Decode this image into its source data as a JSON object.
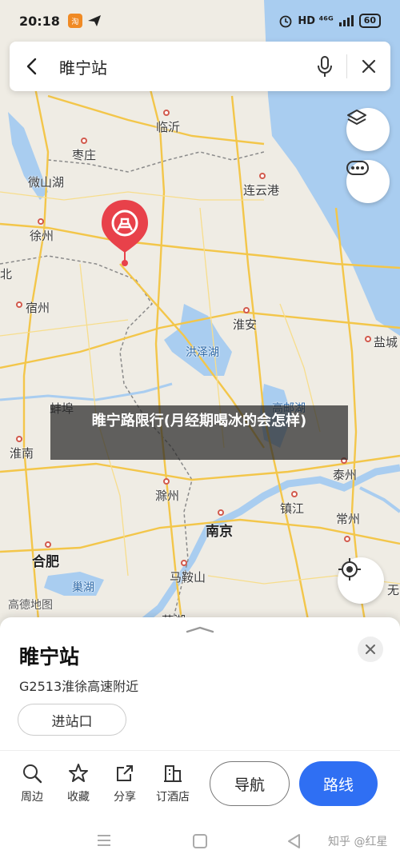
{
  "status_bar": {
    "time": "20:18",
    "network": "HD ⁴⁶ᴳ",
    "battery": "60"
  },
  "search": {
    "query": "睢宁站"
  },
  "map": {
    "cities": {
      "linyi": "临沂",
      "zaozhuang": "枣庄",
      "weishanhu": "微山湖",
      "lianyungang": "连云港",
      "xuzhou": "徐州",
      "bei": "北",
      "suzhou_ah": "宿州",
      "huaian": "淮安",
      "hongzehu": "洪泽湖",
      "yancheng": "盐城",
      "bengbu": "蚌埠",
      "huainan": "淮南",
      "gaoyouhu": "高邮湖",
      "taizhou": "泰州",
      "chuzhou": "滁州",
      "zhenjiang": "镇江",
      "nanjing": "南京",
      "changzhou": "常州",
      "hefei": "合肥",
      "chaohu": "巢湖",
      "maanshan": "马鞍山",
      "wuhu": "芜湖",
      "wu": "无"
    },
    "logo": "高德地图"
  },
  "overlay_caption": "睢宁路限行(月经期喝冰的会怎样)",
  "poi": {
    "name": "睢宁站",
    "address": "G2513淮徐高速附近",
    "entrance": "进站口"
  },
  "actions": {
    "nearby": "周边",
    "favorite": "收藏",
    "share": "分享",
    "hotel": "订酒店",
    "navigate": "导航",
    "route": "路线"
  },
  "watermark": "知乎 @红星",
  "colors": {
    "accent": "#2f6ff3",
    "marker": "#e8414a",
    "water": "#a9cdf0"
  }
}
